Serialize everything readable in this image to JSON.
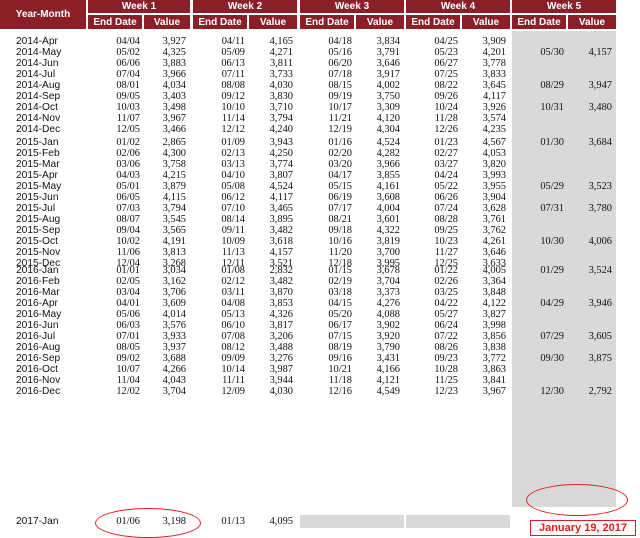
{
  "header": {
    "year_month": "Year-Month",
    "weeks": [
      {
        "title": "Week 1",
        "date_col": "End Date",
        "value_col": "Value"
      },
      {
        "title": "Week 2",
        "date_col": "End Date",
        "value_col": "Value"
      },
      {
        "title": "Week 3",
        "date_col": "End Date",
        "value_col": "Value"
      },
      {
        "title": "Week 4",
        "date_col": "End Date",
        "value_col": "Value"
      },
      {
        "title": "Week 5",
        "date_col": "End Date",
        "value_col": "Value"
      }
    ]
  },
  "rows": [
    {
      "ym": "2014-Apr",
      "w": [
        [
          "04/04",
          "3,927"
        ],
        [
          "04/11",
          "4,165"
        ],
        [
          "04/18",
          "3,834"
        ],
        [
          "04/25",
          "3,909"
        ],
        [
          "",
          ""
        ]
      ]
    },
    {
      "ym": "2014-May",
      "w": [
        [
          "05/02",
          "4,325"
        ],
        [
          "05/09",
          "4,271"
        ],
        [
          "05/16",
          "3,791"
        ],
        [
          "05/23",
          "4,201"
        ],
        [
          "05/30",
          "4,157"
        ]
      ]
    },
    {
      "ym": "2014-Jun",
      "w": [
        [
          "06/06",
          "3,883"
        ],
        [
          "06/13",
          "3,811"
        ],
        [
          "06/20",
          "3,646"
        ],
        [
          "06/27",
          "3,778"
        ],
        [
          "",
          ""
        ]
      ]
    },
    {
      "ym": "2014-Jul",
      "w": [
        [
          "07/04",
          "3,966"
        ],
        [
          "07/11",
          "3,733"
        ],
        [
          "07/18",
          "3,917"
        ],
        [
          "07/25",
          "3,833"
        ],
        [
          "",
          ""
        ]
      ]
    },
    {
      "ym": "2014-Aug",
      "w": [
        [
          "08/01",
          "4,034"
        ],
        [
          "08/08",
          "4,030"
        ],
        [
          "08/15",
          "4,002"
        ],
        [
          "08/22",
          "3,645"
        ],
        [
          "08/29",
          "3,947"
        ]
      ]
    },
    {
      "ym": "2014-Sep",
      "w": [
        [
          "09/05",
          "3,403"
        ],
        [
          "09/12",
          "3,830"
        ],
        [
          "09/19",
          "3,750"
        ],
        [
          "09/26",
          "4,117"
        ],
        [
          "",
          ""
        ]
      ]
    },
    {
      "ym": "2014-Oct",
      "w": [
        [
          "10/03",
          "3,498"
        ],
        [
          "10/10",
          "3,710"
        ],
        [
          "10/17",
          "3,309"
        ],
        [
          "10/24",
          "3,926"
        ],
        [
          "10/31",
          "3,480"
        ]
      ]
    },
    {
      "ym": "2014-Nov",
      "w": [
        [
          "11/07",
          "3,967"
        ],
        [
          "11/14",
          "3,794"
        ],
        [
          "11/21",
          "4,120"
        ],
        [
          "11/28",
          "3,574"
        ],
        [
          "",
          ""
        ]
      ]
    },
    {
      "ym": "2014-Dec",
      "w": [
        [
          "12/05",
          "3,466"
        ],
        [
          "12/12",
          "4,240"
        ],
        [
          "12/19",
          "4,304"
        ],
        [
          "12/26",
          "4,235"
        ],
        [
          "",
          ""
        ]
      ]
    },
    {
      "ym": "2015-Jan",
      "w": [
        [
          "01/02",
          "2,865"
        ],
        [
          "01/09",
          "3,943"
        ],
        [
          "01/16",
          "4,524"
        ],
        [
          "01/23",
          "4,567"
        ],
        [
          "01/30",
          "3,684"
        ]
      ]
    },
    {
      "ym": "2015-Feb",
      "w": [
        [
          "02/06",
          "4,300"
        ],
        [
          "02/13",
          "4,250"
        ],
        [
          "02/20",
          "4,282"
        ],
        [
          "02/27",
          "4,053"
        ],
        [
          "",
          ""
        ]
      ]
    },
    {
      "ym": "2015-Mar",
      "w": [
        [
          "03/06",
          "3,758"
        ],
        [
          "03/13",
          "3,774"
        ],
        [
          "03/20",
          "3,966"
        ],
        [
          "03/27",
          "3,820"
        ],
        [
          "",
          ""
        ]
      ]
    },
    {
      "ym": "2015-Apr",
      "w": [
        [
          "04/03",
          "4,215"
        ],
        [
          "04/10",
          "3,807"
        ],
        [
          "04/17",
          "3,855"
        ],
        [
          "04/24",
          "3,993"
        ],
        [
          "",
          ""
        ]
      ]
    },
    {
      "ym": "2015-May",
      "w": [
        [
          "05/01",
          "3,879"
        ],
        [
          "05/08",
          "4,524"
        ],
        [
          "05/15",
          "4,161"
        ],
        [
          "05/22",
          "3,955"
        ],
        [
          "05/29",
          "3,523"
        ]
      ]
    },
    {
      "ym": "2015-Jun",
      "w": [
        [
          "06/05",
          "4,115"
        ],
        [
          "06/12",
          "4,117"
        ],
        [
          "06/19",
          "3,608"
        ],
        [
          "06/26",
          "3,904"
        ],
        [
          "",
          ""
        ]
      ]
    },
    {
      "ym": "2015-Jul",
      "w": [
        [
          "07/03",
          "3,794"
        ],
        [
          "07/10",
          "3,465"
        ],
        [
          "07/17",
          "4,004"
        ],
        [
          "07/24",
          "3,628"
        ],
        [
          "07/31",
          "3,780"
        ]
      ]
    },
    {
      "ym": "2015-Aug",
      "w": [
        [
          "08/07",
          "3,545"
        ],
        [
          "08/14",
          "3,895"
        ],
        [
          "08/21",
          "3,601"
        ],
        [
          "08/28",
          "3,761"
        ],
        [
          "",
          ""
        ]
      ]
    },
    {
      "ym": "2015-Sep",
      "w": [
        [
          "09/04",
          "3,565"
        ],
        [
          "09/11",
          "3,482"
        ],
        [
          "09/18",
          "4,322"
        ],
        [
          "09/25",
          "3,762"
        ],
        [
          "",
          ""
        ]
      ]
    },
    {
      "ym": "2015-Oct",
      "w": [
        [
          "10/02",
          "4,191"
        ],
        [
          "10/09",
          "3,618"
        ],
        [
          "10/16",
          "3,819"
        ],
        [
          "10/23",
          "4,261"
        ],
        [
          "10/30",
          "4,006"
        ]
      ]
    },
    {
      "ym": "2015-Nov",
      "w": [
        [
          "11/06",
          "3,813"
        ],
        [
          "11/13",
          "4,157"
        ],
        [
          "11/20",
          "3,700"
        ],
        [
          "11/27",
          "3,646"
        ],
        [
          "",
          ""
        ]
      ]
    },
    {
      "ym": "2015-Dec",
      "w": [
        [
          "12/04",
          "3,268"
        ],
        [
          "12/11",
          "3,521"
        ],
        [
          "12/18",
          "3,995"
        ],
        [
          "12/25",
          "3,633"
        ],
        [
          "",
          ""
        ]
      ]
    },
    {
      "ym": "2016-Jan",
      "w": [
        [
          "01/01",
          "3,034"
        ],
        [
          "01/08",
          "2,832"
        ],
        [
          "01/15",
          "3,678"
        ],
        [
          "01/22",
          "4,005"
        ],
        [
          "01/29",
          "3,524"
        ]
      ]
    },
    {
      "ym": "2016-Feb",
      "w": [
        [
          "02/05",
          "3,162"
        ],
        [
          "02/12",
          "3,482"
        ],
        [
          "02/19",
          "3,704"
        ],
        [
          "02/26",
          "3,364"
        ],
        [
          "",
          ""
        ]
      ]
    },
    {
      "ym": "2016-Mar",
      "w": [
        [
          "03/04",
          "3,706"
        ],
        [
          "03/11",
          "3,870"
        ],
        [
          "03/18",
          "3,373"
        ],
        [
          "03/25",
          "3,848"
        ],
        [
          "",
          ""
        ]
      ]
    },
    {
      "ym": "2016-Apr",
      "w": [
        [
          "04/01",
          "3,609"
        ],
        [
          "04/08",
          "3,853"
        ],
        [
          "04/15",
          "4,276"
        ],
        [
          "04/22",
          "4,122"
        ],
        [
          "04/29",
          "3,946"
        ]
      ]
    },
    {
      "ym": "2016-May",
      "w": [
        [
          "05/06",
          "4,014"
        ],
        [
          "05/13",
          "4,326"
        ],
        [
          "05/20",
          "4,088"
        ],
        [
          "05/27",
          "3,827"
        ],
        [
          "",
          ""
        ]
      ]
    },
    {
      "ym": "2016-Jun",
      "w": [
        [
          "06/03",
          "3,576"
        ],
        [
          "06/10",
          "3,817"
        ],
        [
          "06/17",
          "3,902"
        ],
        [
          "06/24",
          "3,998"
        ],
        [
          "",
          ""
        ]
      ]
    },
    {
      "ym": "2016-Jul",
      "w": [
        [
          "07/01",
          "3,933"
        ],
        [
          "07/08",
          "3,206"
        ],
        [
          "07/15",
          "3,920"
        ],
        [
          "07/22",
          "3,856"
        ],
        [
          "07/29",
          "3,605"
        ]
      ]
    },
    {
      "ym": "2016-Aug",
      "w": [
        [
          "08/05",
          "3,937"
        ],
        [
          "08/12",
          "3,488"
        ],
        [
          "08/19",
          "3,790"
        ],
        [
          "08/26",
          "3,838"
        ],
        [
          "",
          ""
        ]
      ]
    },
    {
      "ym": "2016-Sep",
      "w": [
        [
          "09/02",
          "3,688"
        ],
        [
          "09/09",
          "3,276"
        ],
        [
          "09/16",
          "3,431"
        ],
        [
          "09/23",
          "3,772"
        ],
        [
          "09/30",
          "3,875"
        ]
      ]
    },
    {
      "ym": "2016-Oct",
      "w": [
        [
          "10/07",
          "4,266"
        ],
        [
          "10/14",
          "3,987"
        ],
        [
          "10/21",
          "4,166"
        ],
        [
          "10/28",
          "3,863"
        ],
        [
          "",
          ""
        ]
      ]
    },
    {
      "ym": "2016-Nov",
      "w": [
        [
          "11/04",
          "4,043"
        ],
        [
          "11/11",
          "3,944"
        ],
        [
          "11/18",
          "4,121"
        ],
        [
          "11/25",
          "3,841"
        ],
        [
          "",
          ""
        ]
      ]
    },
    {
      "ym": "2016-Dec",
      "w": [
        [
          "12/02",
          "3,704"
        ],
        [
          "12/09",
          "4,030"
        ],
        [
          "12/16",
          "4,549"
        ],
        [
          "12/23",
          "3,967"
        ],
        [
          "12/30",
          "2,792"
        ]
      ]
    },
    {
      "ym": "2017-Jan",
      "w": [
        [
          "01/06",
          "3,198"
        ],
        [
          "01/13",
          "4,095"
        ],
        [
          "",
          ""
        ],
        [
          "",
          ""
        ],
        [
          "",
          ""
        ]
      ]
    }
  ],
  "stamp_date": "January 19, 2017",
  "colors": {
    "header_bg": "#8b1f28",
    "highlight": "#e02020",
    "empty_shade": "#d9d9d9"
  }
}
